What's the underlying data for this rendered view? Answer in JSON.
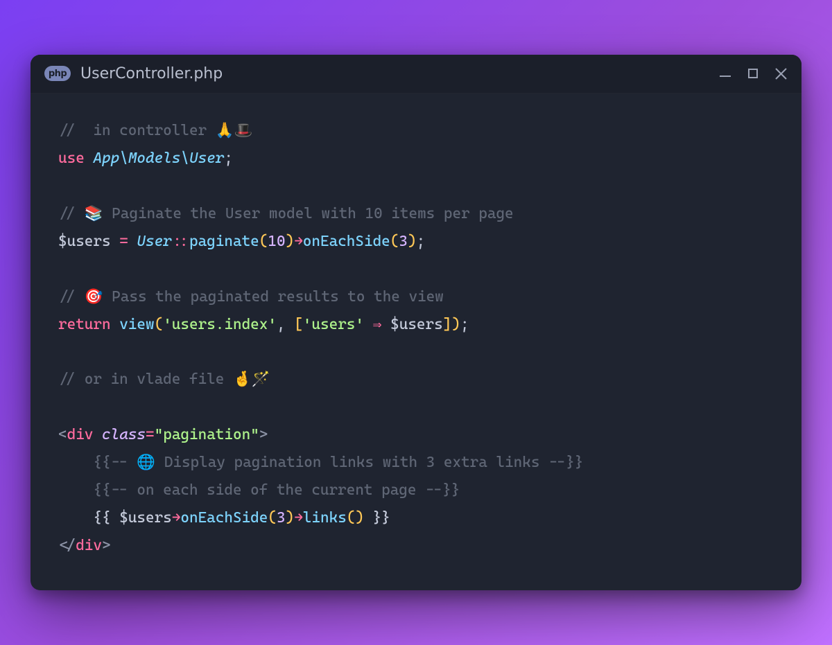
{
  "header": {
    "badge_label": "php",
    "file_title": "UserController.php"
  },
  "code": {
    "l1_comment": "//  in controller 🙏🎩",
    "l2_kw_use": "use",
    "l2_ns1": "App",
    "l2_sep": "\\",
    "l2_ns2": "Models",
    "l2_ns3": "User",
    "l4_comment": "// 📚 Paginate the User model with 10 items per page",
    "l5_var": "$users",
    "l5_assign": " = ",
    "l5_class": "User",
    "l5_scope": "::",
    "l5_fn1": "paginate",
    "l5_num": "10",
    "l5_arrow": "→",
    "l5_fn2": "onEachSide",
    "l5_num2": "3",
    "l7_comment": "// 🎯 Pass the paginated results to the view",
    "l8_kw": "return",
    "l8_fn": "view",
    "l8_str1": "'users.index'",
    "l8_br_open": "[",
    "l8_str2": "'users'",
    "l8_darrow": " ⇒ ",
    "l8_var": "$users",
    "l8_br_close": "]",
    "l10_comment": "// or in vlade file 🤞🪄",
    "l12_open_br": "<",
    "l12_tag": "div",
    "l12_attr": "class",
    "l12_eq": "=",
    "l12_val": "\"pagination\"",
    "l12_close_br": ">",
    "l13_comment": "{{-- 🌐 Display pagination links with 3 extra links --}}",
    "l14_comment": "{{-- on each side of the current page --}}",
    "l15_open": "{{ ",
    "l15_var": "$users",
    "l15_arrow1": "→",
    "l15_fn1": "onEachSide",
    "l15_num": "3",
    "l15_arrow2": "→",
    "l15_fn2": "links",
    "l15_close": " }}",
    "l16_open_br": "</",
    "l16_tag": "div",
    "l16_close_br": ">"
  }
}
